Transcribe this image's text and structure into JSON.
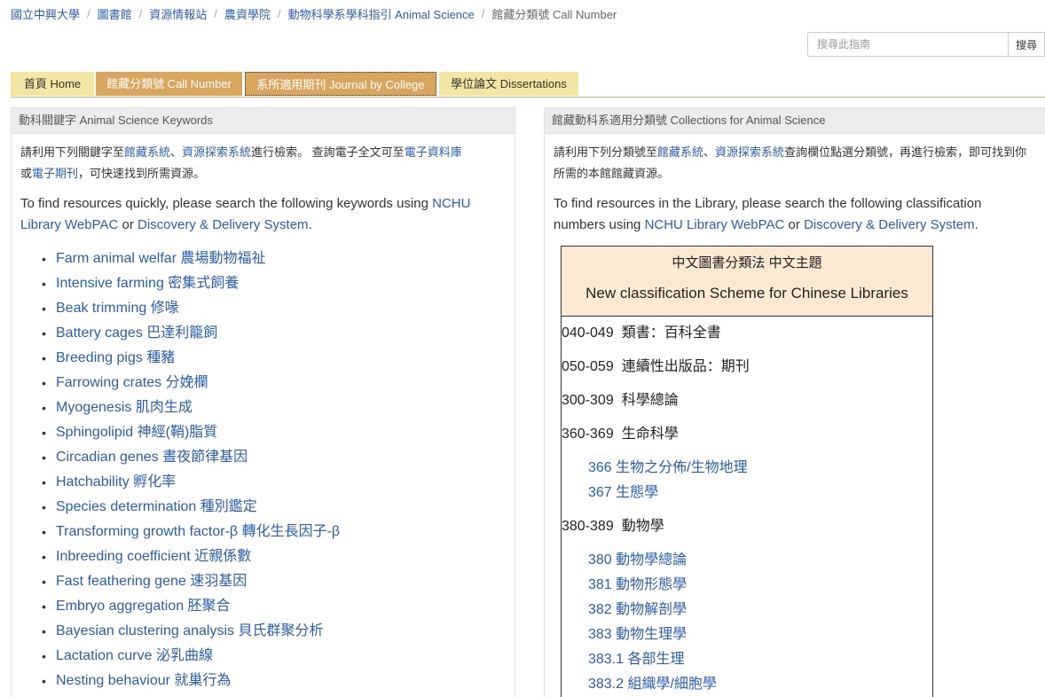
{
  "breadcrumb": [
    {
      "label": "國立中興大學"
    },
    {
      "label": "圖書館"
    },
    {
      "label": "資源情報站"
    },
    {
      "label": "農資學院"
    },
    {
      "label": "動物科學系學科指引 Animal Science"
    },
    {
      "label": "館藏分類號 Call Number"
    }
  ],
  "search": {
    "placeholder": "搜尋此指南",
    "button_label": "搜尋"
  },
  "tabs": [
    {
      "label": "首頁 Home"
    },
    {
      "label": "館藏分類號 Call Number"
    },
    {
      "label": "系所適用期刊 Journal by College"
    },
    {
      "label": "學位論文 Dissertations"
    }
  ],
  "left_panel": {
    "title": "動科關鍵字 Animal Science Keywords",
    "intro_zh": {
      "t1": "請利用下列關鍵字至",
      "l1": "館藏系統",
      "t2": "、",
      "l2": "資源探索系統",
      "t3": "進行檢索。 查詢電子全文可至",
      "l3": "電子資料庫",
      "t4": "或",
      "l4": "電子期刊",
      "t5": "，可快速找到所需資源。"
    },
    "intro_en": {
      "t1": "To find resources quickly, please search the following keywords using ",
      "l1": "NCHU Library WebPAC",
      "t2": " or ",
      "l2": "Discovery & Delivery System",
      "t3": "."
    },
    "keywords": [
      "Farm animal welfar 農場動物福祉",
      "Intensive farming 密集式飼養",
      "Beak trimming 修喙",
      "Battery cages 巴達利籠飼",
      "Breeding pigs 種豬",
      "Farrowing crates 分娩欄",
      "Myogenesis 肌肉生成",
      "Sphingolipid 神經(鞘)脂質",
      "Circadian genes 晝夜節律基因",
      "Hatchability 孵化率",
      "Species determination 種別鑑定",
      "Transforming growth factor-β 轉化生長因子-β",
      "Inbreeding coefficient 近親係數",
      "Fast feathering gene 速羽基因",
      "Embryo aggregation 胚聚合",
      "Bayesian clustering analysis 貝氏群聚分析",
      "Lactation curve 泌乳曲線",
      "Nesting behaviour 就巢行為"
    ]
  },
  "right_panel": {
    "title": "館藏動科系適用分類號 Collections for Animal Science",
    "intro_zh": {
      "t1": "請利用下列分類號至",
      "l1": "館藏系統",
      "t2": "、",
      "l2": "資源探索系統",
      "t3": "查詢欄位點選分類號，再進行檢索，即可找到你所需的本館館藏資源。"
    },
    "intro_en": {
      "t1": "To find resources in the Library, please search the following classification numbers using ",
      "l1": "NCHU Library WebPAC",
      "t2": " or ",
      "l2": "Discovery & Delivery System",
      "t3": "."
    },
    "table": {
      "head_zh": "中文圖書分類法 中文主題",
      "head_en": "New classification Scheme for Chinese Libraries",
      "r1": {
        "code": "040-049",
        "name": "類書：百科全書"
      },
      "r2": {
        "code": "050-059",
        "name": "連續性出版品：期刊"
      },
      "r3": {
        "code": "300-309",
        "name": "科學總論"
      },
      "r4": {
        "code": "360-369",
        "name": "生命科學"
      },
      "r4_sub": [
        "366 生物之分佈/生物地理",
        "367 生態學"
      ],
      "r5": {
        "code": "380-389",
        "name": "動物學"
      },
      "r5_sub": [
        "380 動物學總論",
        "381 動物形態學",
        "382 動物解剖學",
        "383 動物生理學",
        "383.1 各部生理",
        "383.2 組織學/細胞學"
      ]
    }
  },
  "colors": {
    "link": "#2a5db0",
    "tab_active": "#d9a65e",
    "tab_inactive": "#f1e7a3",
    "table_head_bg": "#fbe9d3"
  }
}
